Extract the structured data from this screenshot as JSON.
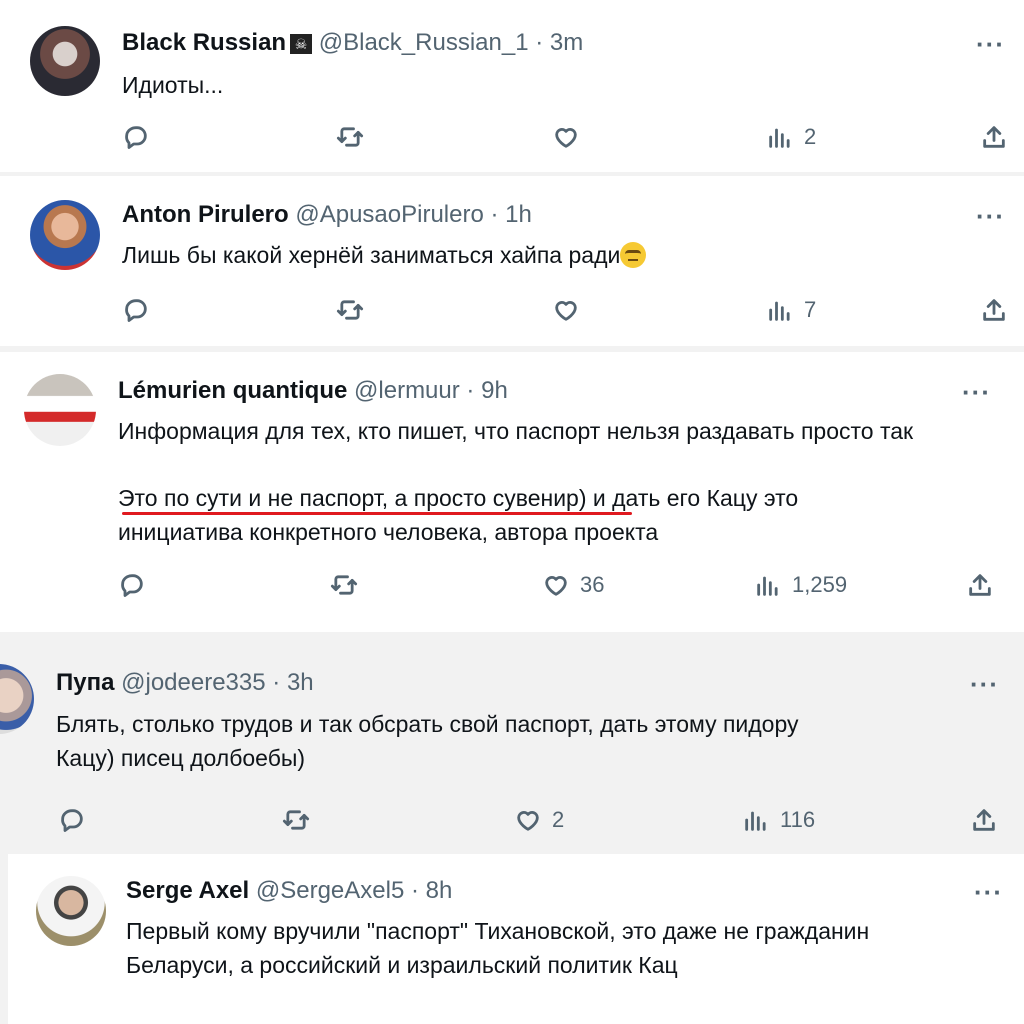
{
  "tweets": [
    {
      "name": "Black Russian",
      "badge": "☠",
      "handle": "@Black_Russian_1",
      "sep": "·",
      "time": "3m",
      "text": "Идиоты...",
      "likes": "",
      "views": "2"
    },
    {
      "name": "Anton Pirulero",
      "handle": "@ApusaoPirulero",
      "sep": "·",
      "time": "1h",
      "text": "Лишь бы какой хернёй заниматься хайпа ради",
      "likes": "",
      "views": "7"
    },
    {
      "name": "Lémurien quantique",
      "handle": "@lermuur",
      "sep": "·",
      "time": "9h",
      "line1": "Информация для тех, кто пишет, что паспорт нельзя раздавать просто так",
      "line2a": "Это по сути и не паспорт, а просто сувенир)",
      "line2b": " и дать его Кацу это",
      "line3": "инициатива конкретного человека, автора проекта",
      "likes": "36",
      "views": "1,259"
    },
    {
      "name": "Пупа",
      "handle": "@jodeere335",
      "sep": "·",
      "time": "3h",
      "line1": "Блять, столько трудов и так обсрать свой паспорт, дать этому пидору",
      "line2": "Кацу) писец долбоебы)",
      "likes": "2",
      "views": "116"
    },
    {
      "name": "Serge Axel",
      "handle": "@SergeAxel5",
      "sep": "·",
      "time": "8h",
      "line1": "Первый кому вручили \"паспорт\" Тихановской, это даже не гражданин",
      "line2": "Беларуси, а российский и израильский политик Кац"
    }
  ],
  "more_label": "···",
  "icons": [
    "reply-icon",
    "retweet-icon",
    "like-icon",
    "views-icon",
    "share-icon",
    "more-icon",
    "skull-crossbones-icon",
    "face-with-rolling-eyes-icon"
  ],
  "colors": {
    "underline": "#e0191f",
    "secondary_text": "#536471"
  }
}
